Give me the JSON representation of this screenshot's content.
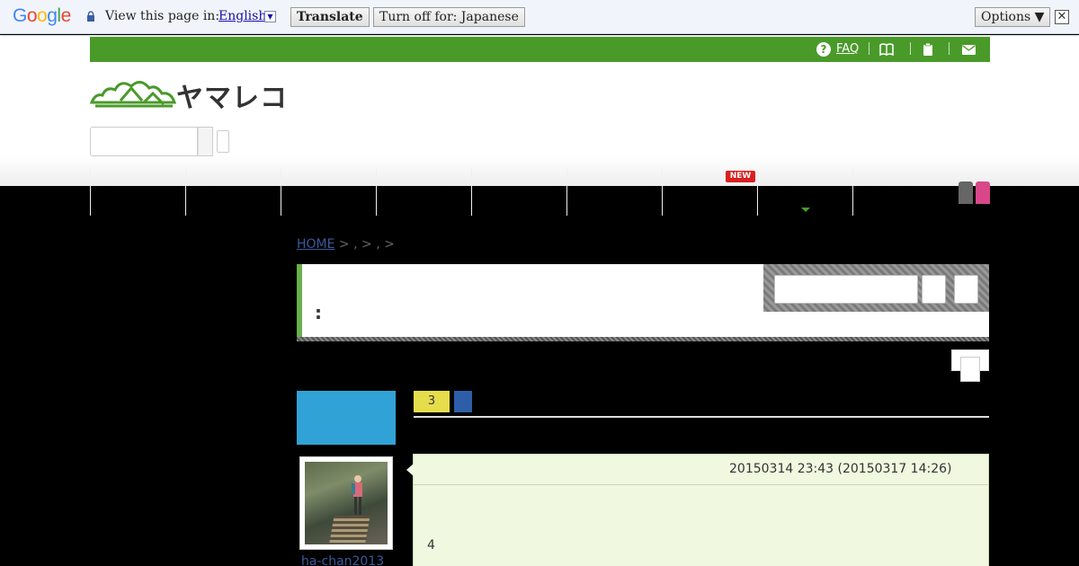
{
  "translate_bar": {
    "logo": "Google",
    "view_label": "View this page in:",
    "language": "English",
    "translate_button": "Translate",
    "turn_off_button": "Turn off for: Japanese",
    "options_button": "Options ▼",
    "close": "✕"
  },
  "utility_bar": {
    "faq_icon": "?",
    "faq_label": "FAQ",
    "icons": [
      "book-icon",
      "clipboard-icon",
      "mail-icon"
    ],
    "accent": "#4a9a2a"
  },
  "brand": {
    "logo_text": "ヤマレコ"
  },
  "nav": {
    "new_badge": "NEW"
  },
  "breadcrumb": {
    "home": "HOME",
    "rest": " > , > , >"
  },
  "title_panel": {
    "title": ":"
  },
  "record": {
    "count_badge": "3"
  },
  "comment": {
    "username": "ha-chan2013",
    "datetime": "20150314 23:43 (20150317 14:26)",
    "body": "4"
  }
}
